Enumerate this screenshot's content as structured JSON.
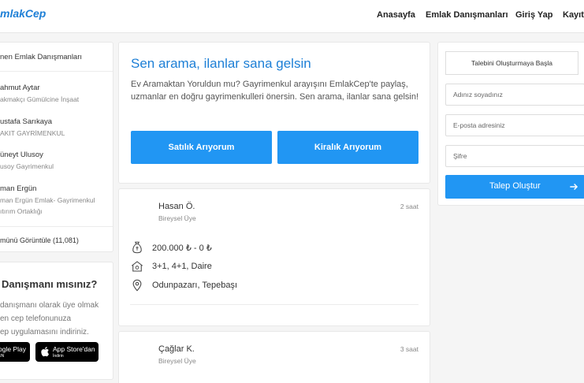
{
  "nav": {
    "logo": "mlakCep",
    "items": [
      "Anasayfa",
      "Emlak Danışmanları",
      "Giriş Yap",
      "Kayıt"
    ]
  },
  "agents": {
    "heading": "nen Emlak Danışmanları",
    "list": [
      {
        "name": "ahmut Aytar",
        "company": "akmakçı Gümülcine İnşaat"
      },
      {
        "name": "ustafa Sarıkaya",
        "company": "AKIT GAYRİMENKUL"
      },
      {
        "name": "üneyt Ulusoy",
        "company": "usoy Gayrimenkul"
      },
      {
        "name": "man Ergün",
        "company": "man Ergün Emlak- Gayrimenkul",
        "company2": "ıtırım Ortaklığı"
      }
    ],
    "view_all": "münü Görüntüle (11,081)"
  },
  "promo": {
    "title": "Danışmanı mısınız?",
    "desc": [
      "danışmanı olarak üye olmak",
      "en cep telefonunuza",
      "ep uygulamasını indiriniz."
    ],
    "google": {
      "big": "ogle Play",
      "small": "UN"
    },
    "apple": {
      "big": "App Store'dan",
      "small": "İndirin"
    }
  },
  "hero": {
    "title": "Sen arama, ilanlar sana gelsin",
    "desc": "Ev Aramaktan Yoruldun mu? Gayrimenkul arayışını EmlakCep'te paylaş, uzmanlar en doğru gayrimenkulleri önersin. Sen arama, ilanlar sana gelsin!",
    "btn_sale": "Satılık Arıyorum",
    "btn_rent": "Kiralık Arıyorum"
  },
  "listings": [
    {
      "name": "Hasan Ö.",
      "type": "Bireysel Üye",
      "time": "2 saat",
      "price": "200.000 ₺ - 0 ₺",
      "rooms": "3+1, 4+1, Daire",
      "location": "Odunpazarı, Tepebaşı"
    },
    {
      "name": "Çağlar K.",
      "type": "Bireysel Üye",
      "time": "3 saat"
    }
  ],
  "form": {
    "heading": "Talebini Oluşturmaya Başla",
    "name_placeholder": "Adınız soyadınız",
    "email_placeholder": "E-posta adresiniz",
    "password_placeholder": "Şifre",
    "submit": "Talep Oluştur"
  },
  "colors": {
    "accent": "#2196f3",
    "brand": "#1d7fd6"
  },
  "icons": [
    "money-bag-icon",
    "house-icon",
    "location-pin-icon",
    "arrow-right-icon",
    "apple-icon",
    "google-play-icon"
  ]
}
